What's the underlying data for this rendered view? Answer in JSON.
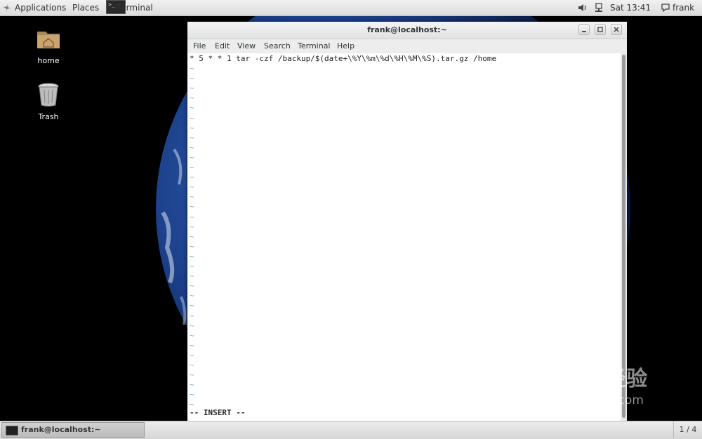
{
  "topbar": {
    "applications_label": "Applications",
    "places_label": "Places",
    "terminal_label": "Terminal",
    "clock": "Sat 13:41",
    "user": "frank"
  },
  "desktop": {
    "icons": [
      {
        "label": "home"
      },
      {
        "label": "Trash"
      }
    ]
  },
  "window": {
    "title": "frank@localhost:~",
    "menu": [
      "File",
      "Edit",
      "View",
      "Search",
      "Terminal",
      "Help"
    ],
    "editor": {
      "line1": "* 5 * * 1 tar -czf /backup/$(date+\\%Y\\%m\\%d\\%H\\%M\\%S).tar.gz /home",
      "tilde": "~",
      "mode": "-- INSERT --"
    }
  },
  "taskbar": {
    "task_label": "frank@localhost:~",
    "pager": "1 / 4"
  },
  "watermark": {
    "brand": "Baidu经验",
    "url": "jingyan.baidu.com"
  }
}
